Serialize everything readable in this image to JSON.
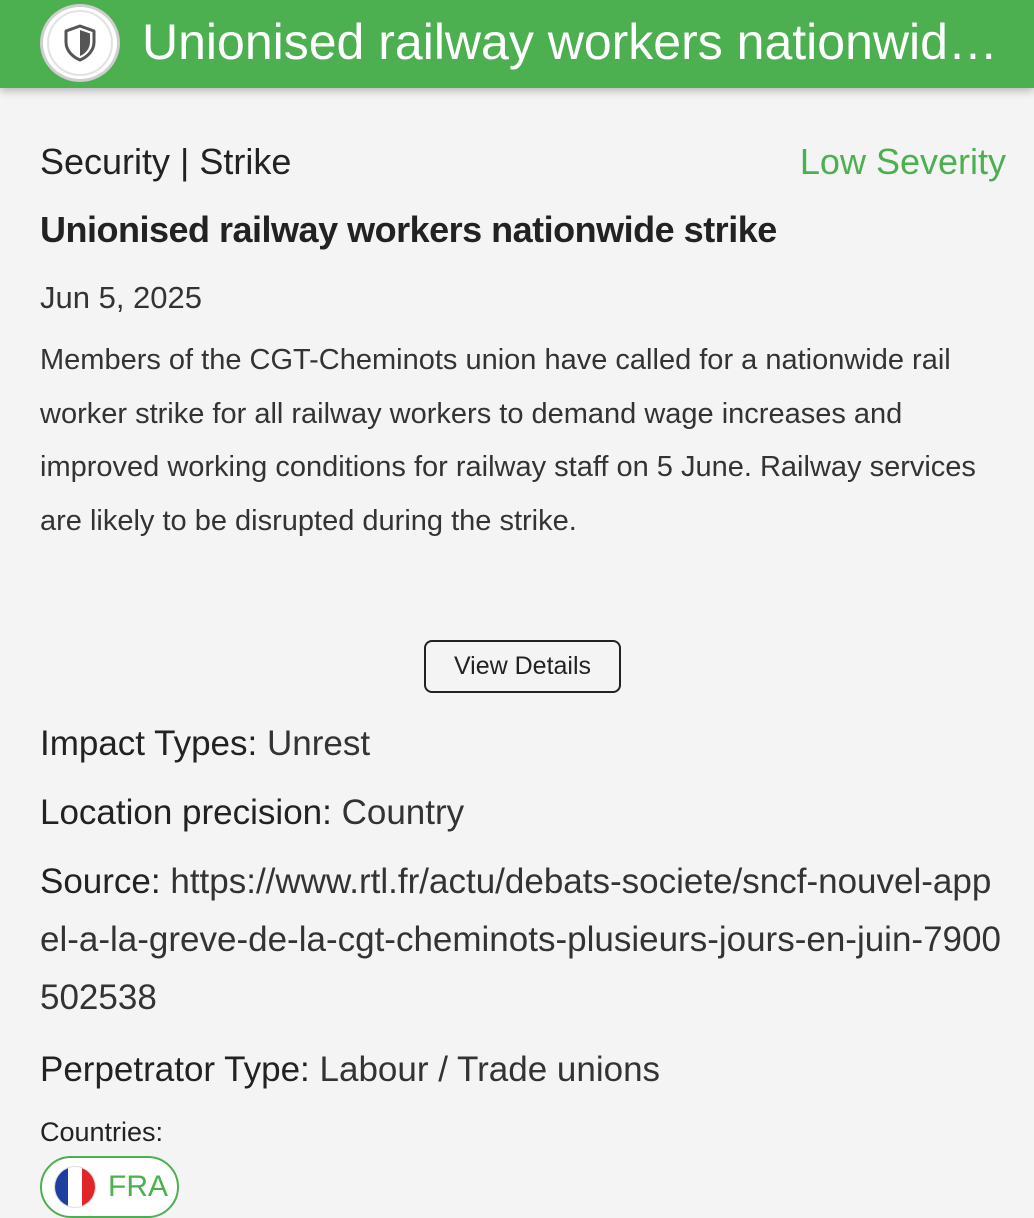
{
  "header": {
    "title": "Unionised railway workers nationwide strike",
    "icon": "shield-icon"
  },
  "alert": {
    "category": "Security | Strike",
    "severity": "Low Severity",
    "title": "Unionised railway workers nationwide strike",
    "date": "Jun 5, 2025",
    "description": "Members of the CGT-Cheminots union have called for a nationwide rail worker strike for all railway workers to demand wage increases and improved working conditions for railway staff on 5 June. Railway services are likely to be disrupted during the strike.",
    "view_details_label": "View Details"
  },
  "fields": {
    "impact_label": "Impact Types:",
    "impact_value": "Unrest",
    "location_label": "Location precision:",
    "location_value": "Country",
    "source_label": "Source:",
    "source_value": "https://www.rtl.fr/actu/debats-societe/sncf-nouvel-appel-a-la-greve-de-la-cgt-cheminots-plusieurs-jours-en-juin-7900502538",
    "perpetrator_label": "Perpetrator Type:",
    "perpetrator_value": "Labour / Trade unions"
  },
  "countries": {
    "label": "Countries:",
    "items": [
      {
        "code": "FRA",
        "flag_colors": [
          "#1f3fa0",
          "#ffffff",
          "#e1262b"
        ]
      }
    ]
  },
  "colors": {
    "accent": "#4caf50",
    "background": "#f4f4f4"
  }
}
